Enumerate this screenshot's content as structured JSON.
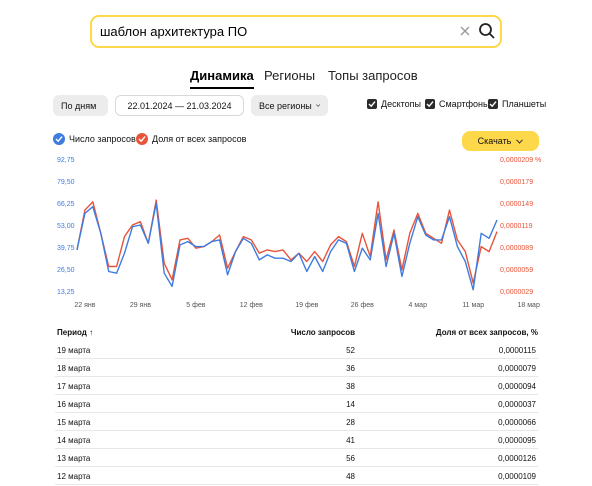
{
  "search": {
    "query": "шаблон архитектура ПО"
  },
  "tabs": [
    {
      "label": "Динамика",
      "active": true
    },
    {
      "label": "Регионы",
      "active": false
    },
    {
      "label": "Топы запросов",
      "active": false
    }
  ],
  "filters": {
    "group_by": "По дням",
    "date_range": "22.01.2024 — 21.03.2024",
    "regions": "Все регионы",
    "devices": [
      {
        "label": "Десктопы",
        "checked": true
      },
      {
        "label": "Смартфоны",
        "checked": true
      },
      {
        "label": "Планшеты",
        "checked": true
      }
    ]
  },
  "legend": {
    "series1": "Число запросов",
    "series2": "Доля от всех запросов"
  },
  "download_label": "Скачать",
  "colors": {
    "accent": "#fdd84a",
    "series1": "#3e7ce0",
    "series2": "#e8543a"
  },
  "chart_data": {
    "type": "line",
    "x_ticks": [
      "22 янв",
      "29 янв",
      "5 фев",
      "12 фев",
      "19 фев",
      "26 фев",
      "4 мар",
      "11 мар",
      "18 мар"
    ],
    "y_ticks_left": [
      "92,75",
      "79,50",
      "66,25",
      "53,00",
      "39,75",
      "26,50",
      "13,25"
    ],
    "y_ticks_right": [
      "0,0000209 %",
      "0,0000179",
      "0,0000149",
      "0,0000119",
      "0,0000089",
      "0,0000059",
      "0,0000029"
    ],
    "ylim": [
      13.25,
      92.75
    ],
    "x_start": "2024-01-21",
    "x_end": "2024-03-19",
    "series": [
      {
        "name": "Число запросов",
        "values": [
          38,
          60,
          64,
          48,
          25,
          24,
          36,
          52,
          53,
          42,
          66,
          24,
          16,
          41,
          43,
          40,
          40,
          43,
          44,
          23,
          37,
          45,
          42,
          32,
          35,
          33,
          33,
          31,
          36,
          25,
          34,
          25,
          37,
          44,
          42,
          25,
          39,
          32,
          60,
          28,
          48,
          22,
          42,
          58,
          47,
          44,
          44,
          58,
          40,
          31,
          14,
          48,
          45,
          56
        ]
      },
      {
        "name": "Доля от всех запросов",
        "values": [
          38,
          62,
          67,
          48,
          28,
          28,
          46,
          53,
          55,
          42,
          68,
          30,
          20,
          44,
          45,
          39,
          40,
          43,
          47,
          27,
          37,
          46,
          44,
          36,
          38,
          37,
          38,
          32,
          36,
          31,
          37,
          31,
          41,
          46,
          43,
          28,
          48,
          34,
          67,
          32,
          50,
          26,
          48,
          60,
          48,
          45,
          42,
          62,
          44,
          37,
          18,
          40,
          37,
          49
        ]
      }
    ]
  },
  "table": {
    "headers": [
      "Период ↑",
      "Число запросов",
      "Доля от всех запросов, %"
    ],
    "rows": [
      [
        "19 марта",
        "52",
        "0,0000115"
      ],
      [
        "18 марта",
        "36",
        "0,0000079"
      ],
      [
        "17 марта",
        "38",
        "0,0000094"
      ],
      [
        "16 марта",
        "14",
        "0,0000037"
      ],
      [
        "15 марта",
        "28",
        "0,0000066"
      ],
      [
        "14 марта",
        "41",
        "0,0000095"
      ],
      [
        "13 марта",
        "56",
        "0,0000126"
      ],
      [
        "12 марта",
        "48",
        "0,0000109"
      ]
    ]
  }
}
